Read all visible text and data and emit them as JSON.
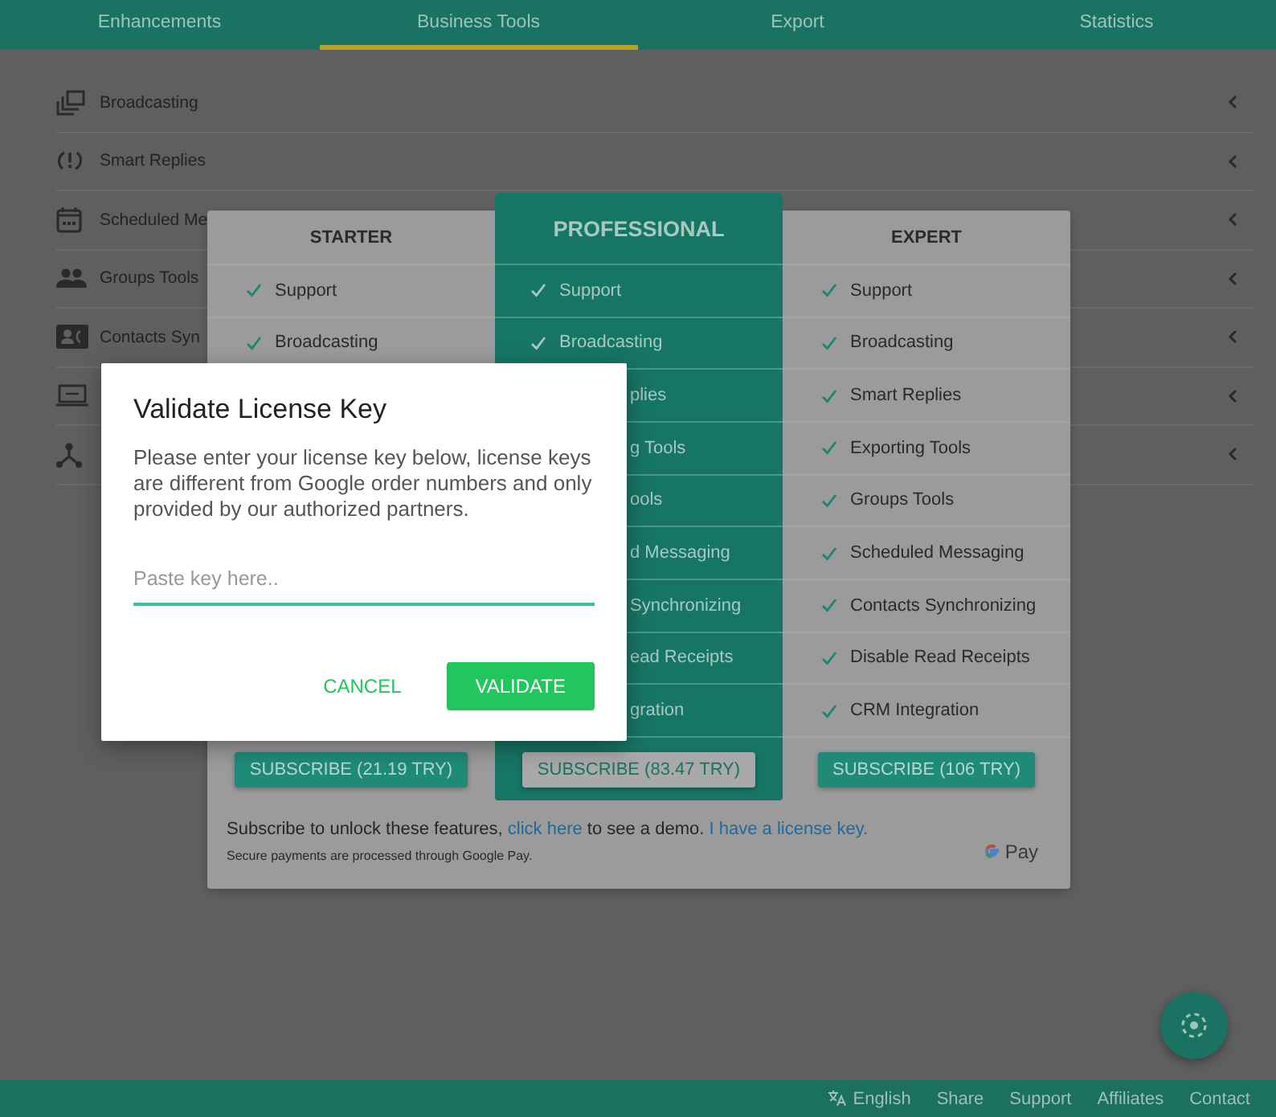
{
  "tabs": [
    {
      "label": "Enhancements",
      "selected": false
    },
    {
      "label": "Business Tools",
      "selected": true
    },
    {
      "label": "Export",
      "selected": false
    },
    {
      "label": "Statistics",
      "selected": false
    }
  ],
  "sidebar": {
    "items": [
      {
        "kind": "broadcast",
        "label": "Broadcasting"
      },
      {
        "kind": "replies",
        "label": "Smart Replies"
      },
      {
        "kind": "calendar",
        "label": "Scheduled Me"
      },
      {
        "kind": "groups",
        "label": "Groups Tools"
      },
      {
        "kind": "contacts",
        "label": "Contacts Syn"
      },
      {
        "kind": "crm"
      },
      {
        "kind": "tree"
      }
    ]
  },
  "plans": [
    {
      "name": "STARTER",
      "highlighted": false,
      "features": [
        {
          "kind": "full",
          "label": "Support"
        },
        {
          "kind": "full",
          "label": "Broadcasting"
        }
      ],
      "subscribe": "SUBSCRIBE (21.19 TRY)"
    },
    {
      "name": "PROFESSIONAL",
      "highlighted": true,
      "features": [
        {
          "kind": "full",
          "label": "Support"
        },
        {
          "kind": "full",
          "label": "Broadcasting"
        },
        {
          "kind": "partial",
          "label": "plies"
        },
        {
          "kind": "partial",
          "label": "g Tools"
        },
        {
          "kind": "partial",
          "label": "ools"
        },
        {
          "kind": "partial",
          "label": "d Messaging"
        },
        {
          "kind": "partial",
          "label": "Synchronizing"
        },
        {
          "kind": "partial",
          "label": "ead Receipts"
        },
        {
          "kind": "partial",
          "label": "gration"
        }
      ],
      "subscribe": "SUBSCRIBE (83.47 TRY)"
    },
    {
      "name": "EXPERT",
      "highlighted": false,
      "features": [
        {
          "kind": "full",
          "label": "Support"
        },
        {
          "kind": "full",
          "label": "Broadcasting"
        },
        {
          "kind": "full",
          "label": "Smart Replies"
        },
        {
          "kind": "full",
          "label": "Exporting Tools"
        },
        {
          "kind": "full",
          "label": "Groups Tools"
        },
        {
          "kind": "full",
          "label": "Scheduled Messaging"
        },
        {
          "kind": "full",
          "label": "Contacts Synchronizing"
        },
        {
          "kind": "full",
          "label": "Disable Read Receipts"
        },
        {
          "kind": "full",
          "label": "CRM Integration"
        }
      ],
      "subscribe": "SUBSCRIBE (106 TRY)"
    }
  ],
  "pricing_footer": {
    "text_before": "Subscribe to unlock these features, ",
    "demo_link": "click here",
    "text_middle": " to see a demo. ",
    "license_link": "I have a license key.",
    "note": "Secure payments are processed through Google Pay.",
    "pay_label": "Pay"
  },
  "dialog": {
    "title": "Validate License Key",
    "message": "Please enter your license key below, license keys are different from Google order numbers and only provided by our authorized partners.",
    "placeholder": "Paste key here..",
    "buttons": [
      {
        "kind": "text",
        "label": "CANCEL"
      },
      {
        "kind": "primary",
        "label": "VALIDATE"
      }
    ]
  },
  "footer": {
    "language": "English",
    "links": [
      "Share",
      "Support",
      "Affiliates",
      "Contact"
    ]
  }
}
